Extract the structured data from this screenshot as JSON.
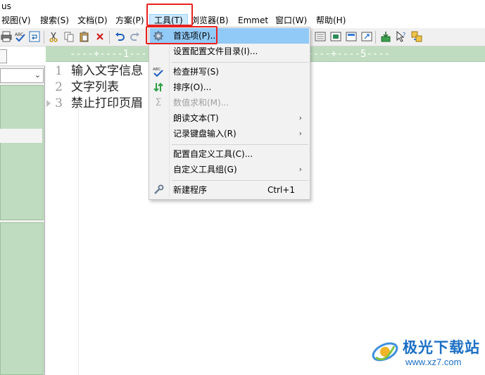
{
  "window": {
    "title": "us"
  },
  "menubar": {
    "items": [
      {
        "label": "视图(V)"
      },
      {
        "label": "搜索(S)"
      },
      {
        "label": "文档(D)"
      },
      {
        "label": "方案(P)"
      },
      {
        "label": "工具(T)"
      },
      {
        "label": "浏览器(B)"
      },
      {
        "label": "Emmet"
      },
      {
        "label": "窗口(W)"
      },
      {
        "label": "帮助(H)"
      }
    ],
    "active_index": 4
  },
  "toolbar": {
    "icons": [
      "print-icon",
      "spellcheck-icon",
      "wrap-icon",
      "cut-icon",
      "copy-icon",
      "paste-icon",
      "delete-icon",
      "undo-icon",
      "redo-icon",
      "view-icon",
      "view2-icon",
      "view3-icon",
      "view4-icon",
      "tool-icon",
      "help-cursor-icon",
      "refresh-icon"
    ]
  },
  "editor": {
    "ruler": "----+----1----+----2----+----3----+----4----+----5----",
    "lines": [
      {
        "num": "1",
        "text": "输入文字信息"
      },
      {
        "num": "2",
        "text": "文字列表"
      },
      {
        "num": "3",
        "text": "禁止打印页眉"
      }
    ]
  },
  "tools_menu": {
    "items": [
      {
        "label": "首选项(P)...",
        "icon": "gear-icon",
        "submenu": false,
        "disabled": false,
        "shortcut": ""
      },
      {
        "label": "设置配置文件目录(I)...",
        "icon": "",
        "submenu": false,
        "disabled": false,
        "shortcut": ""
      },
      {
        "label": "检查拼写(S)",
        "icon": "spellcheck-icon",
        "submenu": false,
        "disabled": false,
        "shortcut": ""
      },
      {
        "label": "排序(O)...",
        "icon": "sort-icon",
        "submenu": false,
        "disabled": false,
        "shortcut": ""
      },
      {
        "label": "数值求和(M)...",
        "icon": "sum-icon",
        "submenu": false,
        "disabled": true,
        "shortcut": ""
      },
      {
        "label": "朗读文本(T)",
        "icon": "",
        "submenu": true,
        "disabled": false,
        "shortcut": ""
      },
      {
        "label": "记录键盘输入(R)",
        "icon": "",
        "submenu": true,
        "disabled": false,
        "shortcut": ""
      },
      {
        "label": "配置自定义工具(C)...",
        "icon": "",
        "submenu": false,
        "disabled": false,
        "shortcut": ""
      },
      {
        "label": "自定义工具组(G)",
        "icon": "",
        "submenu": true,
        "disabled": false,
        "shortcut": ""
      },
      {
        "label": "新建程序",
        "icon": "wrench-icon",
        "submenu": false,
        "disabled": false,
        "shortcut": "Ctrl+1"
      }
    ],
    "submenu_arrow": "›"
  },
  "watermark": {
    "name": "极光下载站",
    "url": "www.xz7.com"
  },
  "colors": {
    "highlight_box": "#e8211d",
    "menu_hover": "#91c9f7",
    "pane_green": "#c0dcc0",
    "watermark_blue": "#1a6fc4"
  }
}
